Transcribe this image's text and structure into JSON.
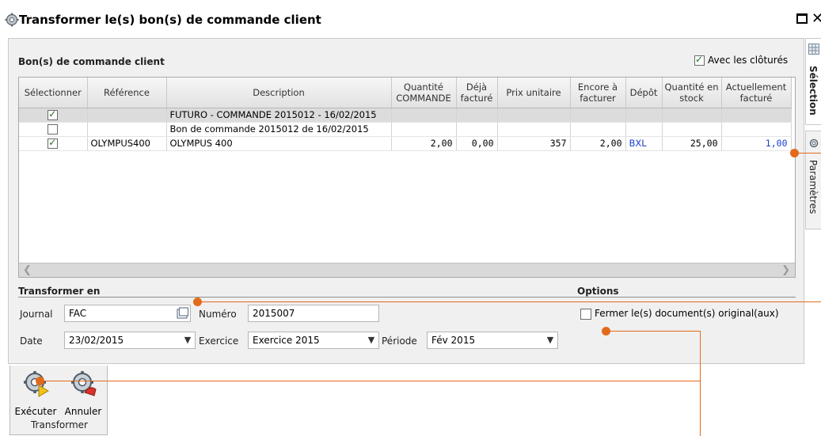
{
  "window": {
    "title": "Transformer le(s) bon(s) de commande client"
  },
  "orders": {
    "section_title": "Bon(s) de commande client",
    "avec_clotures": {
      "label": "Avec les clôturés",
      "checked": true
    },
    "columns": [
      "Sélectionner",
      "Référence",
      "Description",
      "Quantité COMMANDE",
      "Déjà facturé",
      "Prix unitaire",
      "Encore à facturer",
      "Dépôt",
      "Quantité en stock",
      "Actuellement facturé"
    ],
    "rows": [
      {
        "selected": true,
        "reference": "",
        "description": "FUTURO - COMMANDE 2015012 - 16/02/2015",
        "qty_commande": "",
        "deja_facture": "",
        "prix_unitaire": "",
        "encore_a_facturer": "",
        "depot": "",
        "qty_stock": "",
        "actuellement_facture": ""
      },
      {
        "selected": false,
        "reference": "",
        "description": "Bon de commande  2015012 de 16/02/2015",
        "qty_commande": "",
        "deja_facture": "",
        "prix_unitaire": "",
        "encore_a_facturer": "",
        "depot": "",
        "qty_stock": "",
        "actuellement_facture": ""
      },
      {
        "selected": true,
        "reference": "OLYMPUS400",
        "description": "OLYMPUS 400",
        "qty_commande": "2,00",
        "deja_facture": "0,00",
        "prix_unitaire": "357",
        "encore_a_facturer": "2,00",
        "depot": "BXL",
        "qty_stock": "25,00",
        "actuellement_facture": "1,00"
      }
    ]
  },
  "transform": {
    "section_title": "Transformer en",
    "journal_label": "Journal",
    "journal_value": "FAC",
    "numero_label": "Numéro",
    "numero_value": "2015007",
    "date_label": "Date",
    "date_value": "23/02/2015",
    "exercice_label": "Exercice",
    "exercice_value": "Exercice 2015",
    "periode_label": "Période",
    "periode_value": "Fév 2015"
  },
  "options": {
    "section_title": "Options",
    "fermer_label": "Fermer le(s) document(s) original(aux)",
    "fermer_checked": false
  },
  "side_tabs": {
    "selection": "Sélection",
    "parametres": "Paramètres"
  },
  "toolbar": {
    "execute_label": "Exécuter",
    "cancel_label": "Annuler",
    "group_label": "Transformer"
  },
  "colors": {
    "annotation": "#e26a1b",
    "link_blue": "#1a3fcf",
    "selected_row": "#dcdcdc"
  }
}
